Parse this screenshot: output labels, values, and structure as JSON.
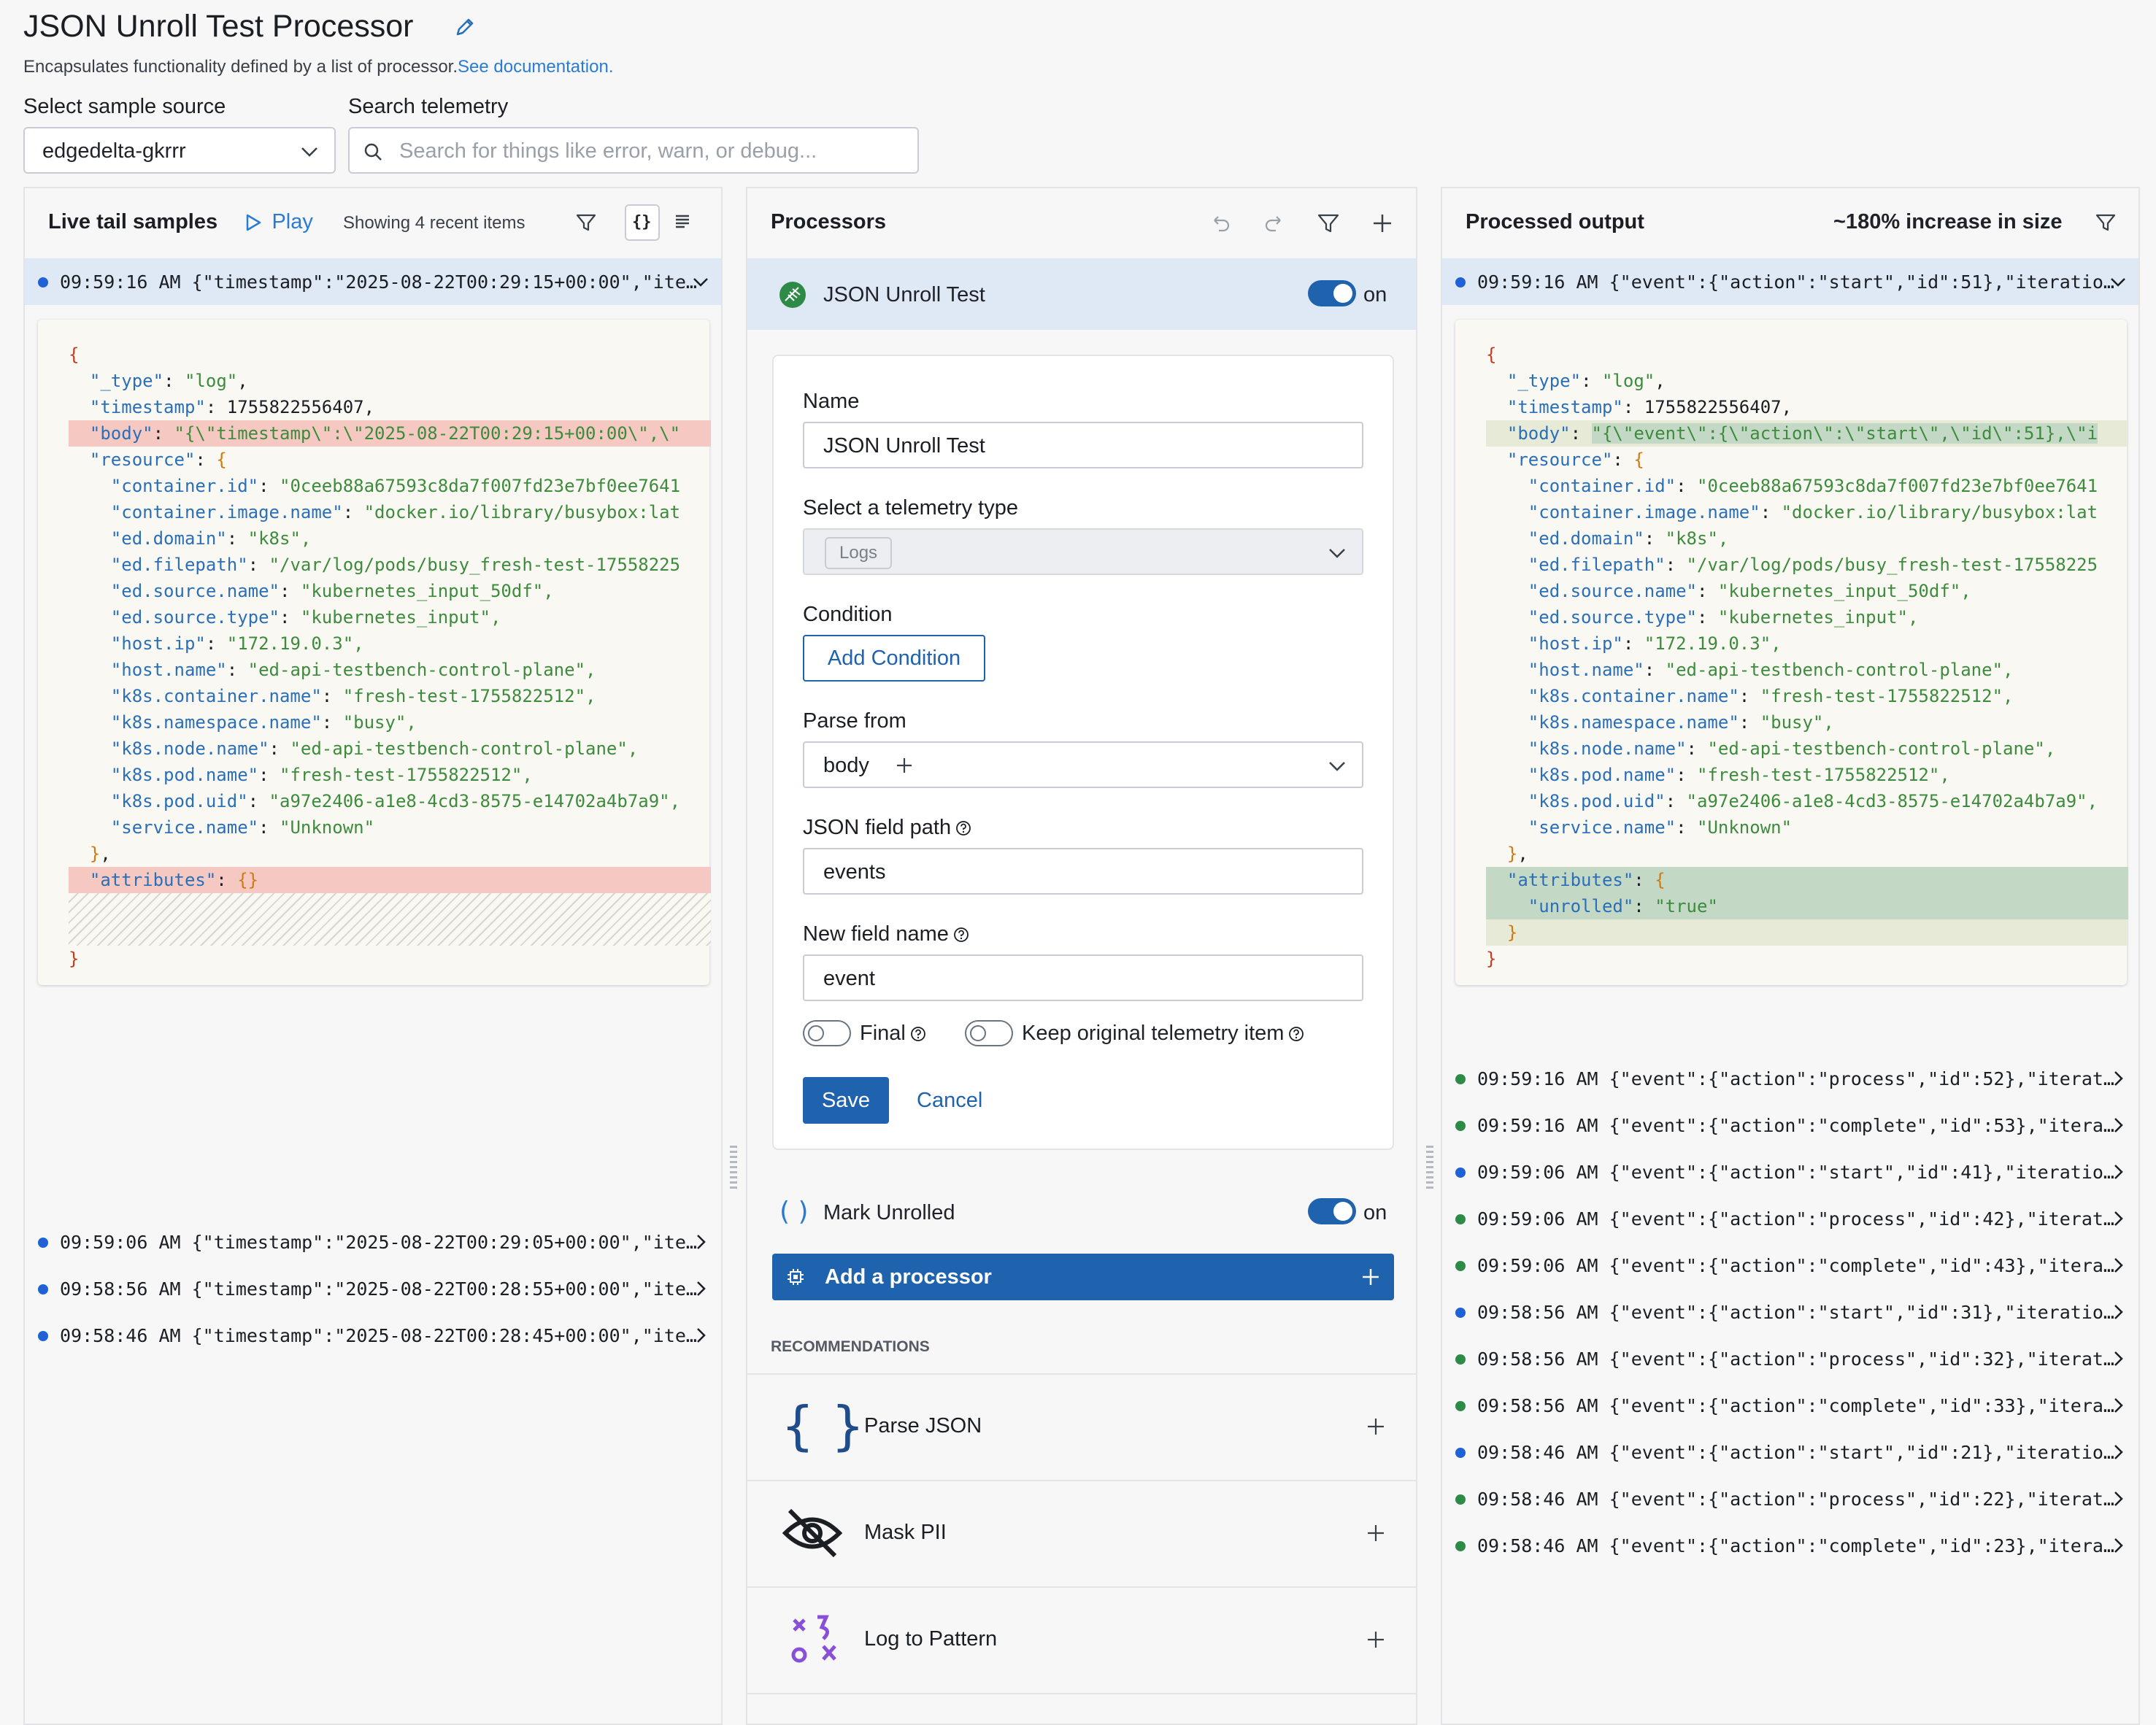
{
  "header": {
    "title": "JSON Unroll Test Processor",
    "subtitle": "Encapsulates functionality defined by a list of processor.",
    "doc_link": "See documentation."
  },
  "filters": {
    "source_label": "Select sample source",
    "source_value": "edgedelta-gkrrr",
    "search_label": "Search telemetry",
    "search_placeholder": "Search for things like error, warn, or debug..."
  },
  "left": {
    "title": "Live tail samples",
    "play": "Play",
    "showing": "Showing 4 recent items",
    "selected": "09:59:16 AM {\"timestamp\":\"2025-08-22T00:29:15+00:00\",\"ite…",
    "rows": [
      "09:59:06 AM {\"timestamp\":\"2025-08-22T00:29:05+00:00\",\"ite…",
      "09:58:56 AM {\"timestamp\":\"2025-08-22T00:28:55+00:00\",\"ite…",
      "09:58:46 AM {\"timestamp\":\"2025-08-22T00:28:45+00:00\",\"ite…"
    ],
    "json": {
      "open": "{",
      "type_key": "\"_type\"",
      "type_val": "\"log\"",
      "ts_key": "\"timestamp\"",
      "ts_val": "1755822556407",
      "body_key": "\"body\"",
      "body_val": "\"{\\\"timestamp\\\":\\\"2025-08-22T00:29:15+00:00\\\",\\\"",
      "res_key": "\"resource\"",
      "resource": [
        [
          "\"container.id\"",
          "\"0ceeb88a67593c8da7f007fd23e7bf0ee7641"
        ],
        [
          "\"container.image.name\"",
          "\"docker.io/library/busybox:lat"
        ],
        [
          "\"ed.domain\"",
          "\"k8s\","
        ],
        [
          "\"ed.filepath\"",
          "\"/var/log/pods/busy_fresh-test-17558225"
        ],
        [
          "\"ed.source.name\"",
          "\"kubernetes_input_50df\","
        ],
        [
          "\"ed.source.type\"",
          "\"kubernetes_input\","
        ],
        [
          "\"host.ip\"",
          "\"172.19.0.3\","
        ],
        [
          "\"host.name\"",
          "\"ed-api-testbench-control-plane\","
        ],
        [
          "\"k8s.container.name\"",
          "\"fresh-test-1755822512\","
        ],
        [
          "\"k8s.namespace.name\"",
          "\"busy\","
        ],
        [
          "\"k8s.node.name\"",
          "\"ed-api-testbench-control-plane\","
        ],
        [
          "\"k8s.pod.name\"",
          "\"fresh-test-1755822512\","
        ],
        [
          "\"k8s.pod.uid\"",
          "\"a97e2406-a1e8-4cd3-8575-e14702a4b7a9\","
        ],
        [
          "\"service.name\"",
          "\"Unknown\""
        ]
      ],
      "attr_key": "\"attributes\"",
      "attr_val": "{}",
      "close": "}"
    }
  },
  "middle": {
    "title": "Processors",
    "proc1_name": "JSON Unroll Test",
    "proc1_state": "on",
    "form": {
      "name_label": "Name",
      "name_value": "JSON Unroll Test",
      "type_label": "Select a telemetry type",
      "type_value": "Logs",
      "condition_label": "Condition",
      "add_condition": "Add Condition",
      "parse_label": "Parse from",
      "parse_value": "body",
      "path_label": "JSON field path",
      "path_value": "events",
      "newfield_label": "New field name",
      "newfield_value": "event",
      "final_label": "Final",
      "keep_label": "Keep original telemetry item",
      "save": "Save",
      "cancel": "Cancel"
    },
    "proc2_name": "Mark Unrolled",
    "proc2_state": "on",
    "add_processor": "Add a processor",
    "rec_heading": "RECOMMENDATIONS",
    "recs": [
      "Parse JSON",
      "Mask PII",
      "Log to Pattern"
    ]
  },
  "right": {
    "title": "Processed output",
    "size_change": "~180% increase in size",
    "selected": "09:59:16 AM {\"event\":{\"action\":\"start\",\"id\":51},\"iteratio…",
    "rows": [
      "09:59:16 AM {\"event\":{\"action\":\"process\",\"id\":52},\"iterat…",
      "09:59:16 AM {\"event\":{\"action\":\"complete\",\"id\":53},\"itera…",
      "09:59:06 AM {\"event\":{\"action\":\"start\",\"id\":41},\"iteratio…",
      "09:59:06 AM {\"event\":{\"action\":\"process\",\"id\":42},\"iterat…",
      "09:59:06 AM {\"event\":{\"action\":\"complete\",\"id\":43},\"itera…",
      "09:58:56 AM {\"event\":{\"action\":\"start\",\"id\":31},\"iteratio…",
      "09:58:56 AM {\"event\":{\"action\":\"process\",\"id\":32},\"iterat…",
      "09:58:56 AM {\"event\":{\"action\":\"complete\",\"id\":33},\"itera…",
      "09:58:46 AM {\"event\":{\"action\":\"start\",\"id\":21},\"iteratio…",
      "09:58:46 AM {\"event\":{\"action\":\"process\",\"id\":22},\"iterat…",
      "09:58:46 AM {\"event\":{\"action\":\"complete\",\"id\":23},\"itera…"
    ],
    "row_dots": [
      "green",
      "green",
      "blue",
      "green",
      "green",
      "blue",
      "green",
      "green",
      "blue",
      "green",
      "green"
    ],
    "json": {
      "body_val": "\"{\\\"event\\\":{\\\"action\\\":\\\"start\\\",\\\"id\\\":51},\\\"i",
      "attr_open": "{",
      "unrolled_key": "\"unrolled\"",
      "unrolled_val": "\"true\"",
      "attr_close": "}"
    }
  },
  "colors": {
    "accent": "#1f62ad",
    "removed_bg": "#f5c9c1",
    "added_bg": "#c3d9c5",
    "selected_row": "#dfe8f5"
  }
}
